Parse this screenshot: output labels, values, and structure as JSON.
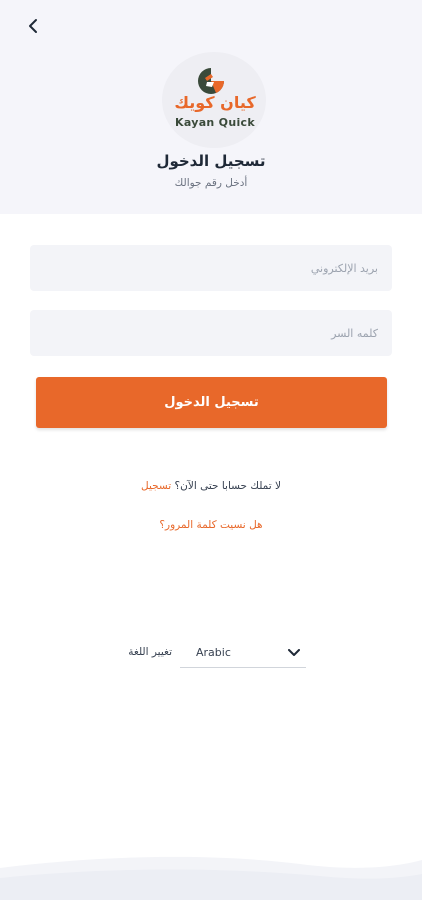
{
  "header": {
    "back_icon": "chevron-left-icon",
    "logo_text_ar": "كيان كويك",
    "logo_text_en": "Kayan Quick",
    "title": "تسجيل الدخول",
    "subtitle": "أدخل رقم جوالك"
  },
  "form": {
    "email_placeholder": "بريد الإلكتروني",
    "password_placeholder": "كلمه السر",
    "login_button": "تسجيل الدخول"
  },
  "links": {
    "no_account_text": "لا تملك حسابا حتى الآن؟",
    "register_link": "تسجيل",
    "forgot_password": "هل نسيت كلمة المرور؟"
  },
  "language": {
    "label": "تغيير اللغة",
    "selected": "Arabic",
    "dropdown_icon": "chevron-down-icon"
  },
  "colors": {
    "accent": "#e8682a",
    "logo_green": "#3a4a3a",
    "header_bg": "#f5f5fa",
    "field_bg": "#f3f4f8"
  }
}
